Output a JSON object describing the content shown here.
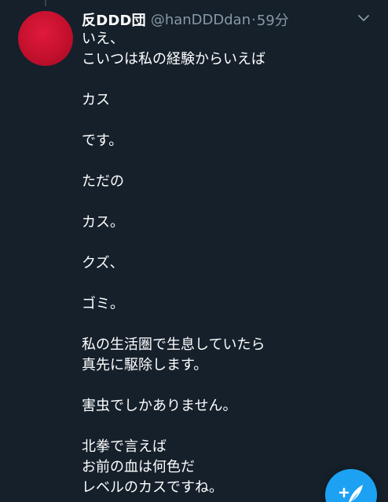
{
  "tweet": {
    "display_name": "反DDD団",
    "handle": "@hanDDDdan",
    "separator": "·",
    "time": "59分",
    "lines": [
      "いえ、",
      "こいつは私の経験からいえば",
      "",
      "カス",
      "",
      "です。",
      "",
      "ただの",
      "",
      "カス。",
      "",
      "クズ、",
      "",
      "ゴミ。",
      "",
      "私の生活圏で生息していたら",
      "真先に駆除します。",
      "",
      "害虫でしかありません。",
      "",
      "北拳で言えば",
      "お前の血は何色だ",
      "レベルのカスですね。"
    ]
  },
  "icons": {
    "menu": "chevron-down-icon",
    "compose": "compose-tweet-icon"
  },
  "colors": {
    "background": "#15202b",
    "primary_text": "#ffffff",
    "secondary_text": "#8899a6",
    "accent": "#1da1f2",
    "avatar": "#c4102d"
  }
}
